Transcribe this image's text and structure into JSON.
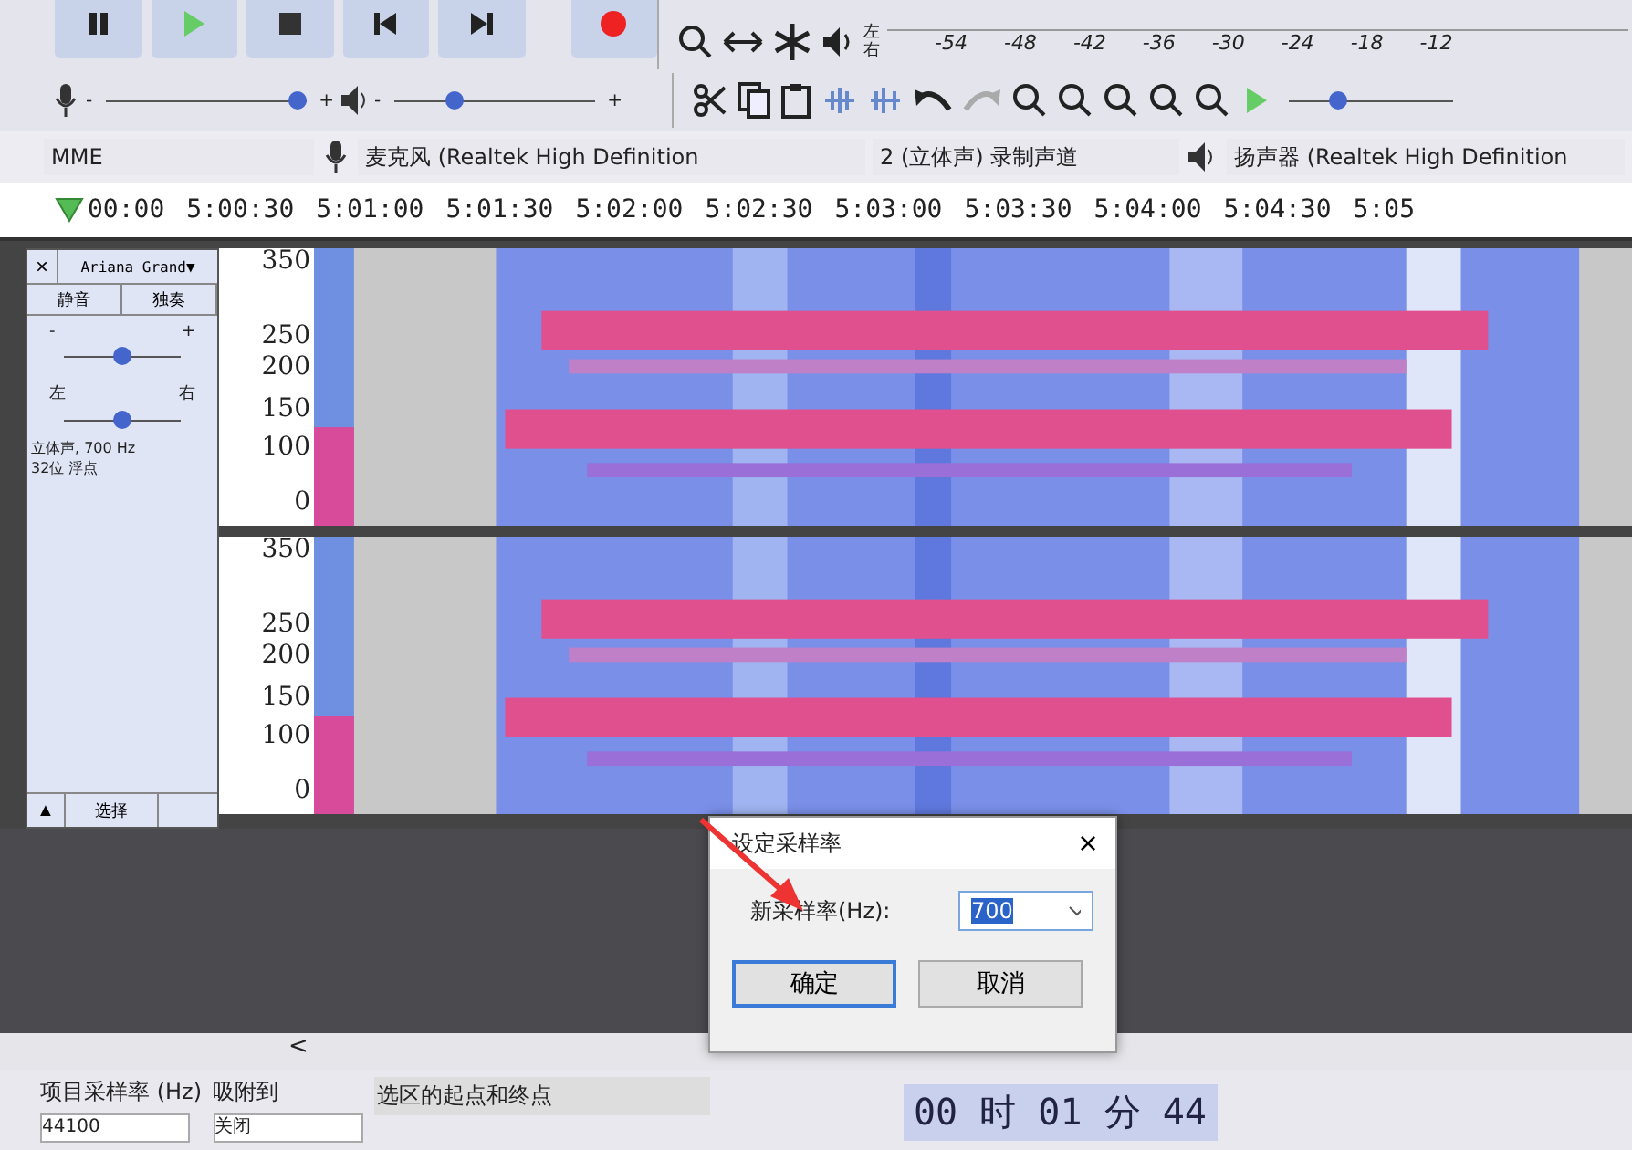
{
  "toolbar": {
    "transport": [
      {
        "kind": "pause"
      },
      {
        "kind": "play"
      },
      {
        "kind": "stop"
      },
      {
        "kind": "start"
      },
      {
        "kind": "end"
      },
      {
        "kind": "record"
      }
    ],
    "meter": {
      "left": "左",
      "right": "右",
      "ticks": [
        "-54",
        "-48",
        "-42",
        "-36",
        "-30",
        "-24",
        "-18",
        "-12"
      ]
    },
    "mic_slider": {
      "min": "-",
      "max": "+",
      "level": 1.0
    },
    "play_slider": {
      "min": "-",
      "max": "+",
      "level": 0.3
    },
    "speed_slider": {
      "level": 0.3
    }
  },
  "device_bar": {
    "host": "MME",
    "microphone": "麦克风 (Realtek High Definition",
    "channels": "2 (立体声) 录制声道",
    "speaker": "扬声器 (Realtek High Definition"
  },
  "timeline": [
    "00:00",
    "5:00:30",
    "5:01:00",
    "5:01:30",
    "5:02:00",
    "5:02:30",
    "5:03:00",
    "5:03:30",
    "5:04:00",
    "5:04:30",
    "5:05"
  ],
  "track": {
    "close": "×",
    "name": "Ariana Grand▼",
    "mute": "静音",
    "solo": "独奏",
    "gain": {
      "min": "-",
      "max": "+",
      "level": 0.5
    },
    "pan": {
      "left": "左",
      "right": "右",
      "level": 0.5
    },
    "info": [
      "立体声, 700 Hz",
      "32位 浮点"
    ],
    "collapse": "▲",
    "select": "选择",
    "channels": [
      {
        "axis": [
          "350",
          "250",
          "200",
          "150",
          "100",
          "0"
        ]
      },
      {
        "axis": [
          "350",
          "250",
          "200",
          "150",
          "100",
          "0"
        ]
      }
    ]
  },
  "scrollbar": {
    "left": "<"
  },
  "dialog": {
    "title": "设定采样率",
    "close": "×",
    "label": "新采样率(Hz):",
    "value": "700",
    "ok": "确定",
    "cancel": "取消"
  },
  "bottom": {
    "rate_label": "项目采样率 (Hz)",
    "rate_value": "44100",
    "snap_label": "吸附到",
    "snap_value": "关闭",
    "selection_label": "选区的起点和终点",
    "time": "00 时 01 分 44"
  }
}
